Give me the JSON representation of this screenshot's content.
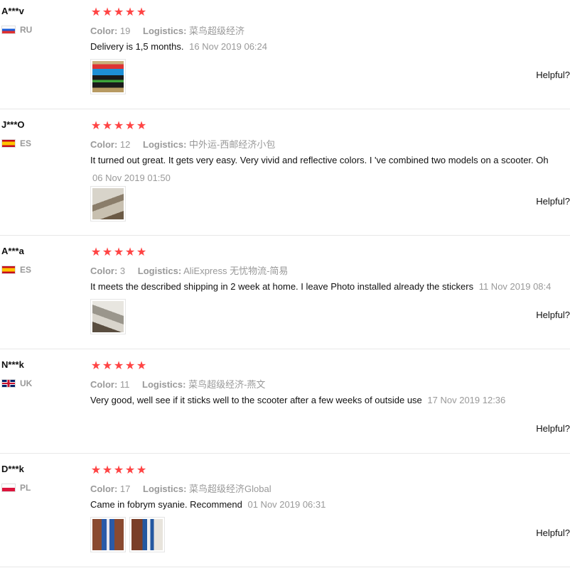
{
  "reviews": [
    {
      "user": "A***v",
      "country": "RU",
      "flag": "ru",
      "rating": 5,
      "color_label": "Color:",
      "color_value": "19",
      "logistics_label": "Logistics:",
      "logistics_value": "菜鸟超级经济",
      "text": "Delivery is 1,5 months.",
      "date": "16 Nov 2019 06:24",
      "helpful": "Helpful?"
    },
    {
      "user": "J***O",
      "country": "ES",
      "flag": "es",
      "rating": 5,
      "color_label": "Color:",
      "color_value": "12",
      "logistics_label": "Logistics:",
      "logistics_value": "中外运-西邮经济小包",
      "text": "It turned out great. It gets very easy. Very vivid and reflective colors. I 've combined two models on a scooter. Oh",
      "date": "06 Nov 2019 01:50",
      "helpful": "Helpful?"
    },
    {
      "user": "A***a",
      "country": "ES",
      "flag": "es",
      "rating": 5,
      "color_label": "Color:",
      "color_value": "3",
      "logistics_label": "Logistics:",
      "logistics_value": "AliExpress 无忧物流-简易",
      "text": "It meets the described shipping in 2 week at home. I leave Photo installed already the stickers",
      "date": "11 Nov 2019 08:4",
      "helpful": "Helpful?"
    },
    {
      "user": "N***k",
      "country": "UK",
      "flag": "uk",
      "rating": 5,
      "color_label": "Color:",
      "color_value": "11",
      "logistics_label": "Logistics:",
      "logistics_value": "菜鸟超级经济-燕文",
      "text": "Very good, well see if it sticks well to the scooter after a few weeks of outside use",
      "date": "17 Nov 2019 12:36",
      "helpful": "Helpful?"
    },
    {
      "user": "D***k",
      "country": "PL",
      "flag": "pl",
      "rating": 5,
      "color_label": "Color:",
      "color_value": "17",
      "logistics_label": "Logistics:",
      "logistics_value": "菜鸟超级经济Global",
      "text": "Came in fobrym syanie. Recommend",
      "date": "01 Nov 2019 06:31",
      "helpful": "Helpful?"
    }
  ],
  "colors": {
    "star": "#ff4747",
    "muted": "#999999",
    "divider": "#e8e8e8"
  },
  "icons": {
    "star": "star-icon",
    "flag": "flag-icon",
    "thumbnail": "review-photo"
  }
}
